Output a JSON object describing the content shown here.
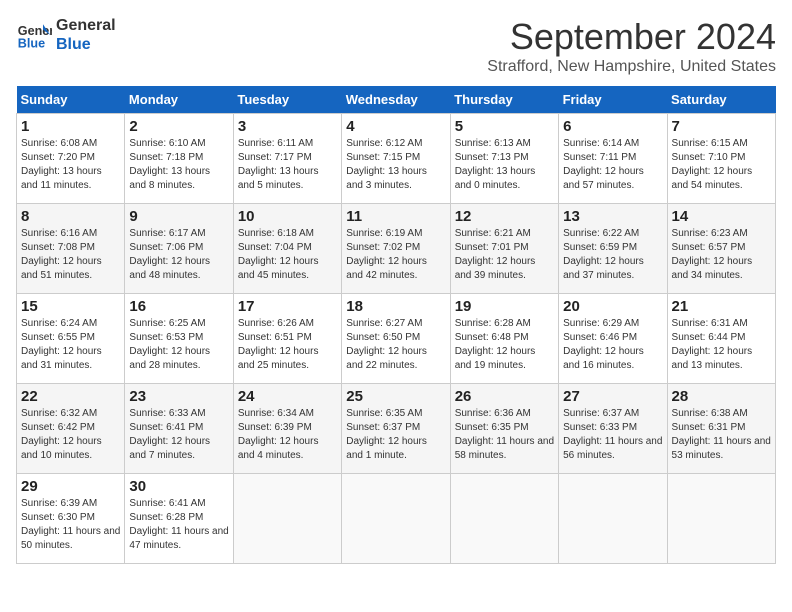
{
  "header": {
    "logo_general": "General",
    "logo_blue": "Blue",
    "month": "September 2024",
    "location": "Strafford, New Hampshire, United States"
  },
  "days_of_week": [
    "Sunday",
    "Monday",
    "Tuesday",
    "Wednesday",
    "Thursday",
    "Friday",
    "Saturday"
  ],
  "weeks": [
    [
      {
        "day": "1",
        "sunrise": "6:08 AM",
        "sunset": "7:20 PM",
        "daylight": "13 hours and 11 minutes."
      },
      {
        "day": "2",
        "sunrise": "6:10 AM",
        "sunset": "7:18 PM",
        "daylight": "13 hours and 8 minutes."
      },
      {
        "day": "3",
        "sunrise": "6:11 AM",
        "sunset": "7:17 PM",
        "daylight": "13 hours and 5 minutes."
      },
      {
        "day": "4",
        "sunrise": "6:12 AM",
        "sunset": "7:15 PM",
        "daylight": "13 hours and 3 minutes."
      },
      {
        "day": "5",
        "sunrise": "6:13 AM",
        "sunset": "7:13 PM",
        "daylight": "13 hours and 0 minutes."
      },
      {
        "day": "6",
        "sunrise": "6:14 AM",
        "sunset": "7:11 PM",
        "daylight": "12 hours and 57 minutes."
      },
      {
        "day": "7",
        "sunrise": "6:15 AM",
        "sunset": "7:10 PM",
        "daylight": "12 hours and 54 minutes."
      }
    ],
    [
      {
        "day": "8",
        "sunrise": "6:16 AM",
        "sunset": "7:08 PM",
        "daylight": "12 hours and 51 minutes."
      },
      {
        "day": "9",
        "sunrise": "6:17 AM",
        "sunset": "7:06 PM",
        "daylight": "12 hours and 48 minutes."
      },
      {
        "day": "10",
        "sunrise": "6:18 AM",
        "sunset": "7:04 PM",
        "daylight": "12 hours and 45 minutes."
      },
      {
        "day": "11",
        "sunrise": "6:19 AM",
        "sunset": "7:02 PM",
        "daylight": "12 hours and 42 minutes."
      },
      {
        "day": "12",
        "sunrise": "6:21 AM",
        "sunset": "7:01 PM",
        "daylight": "12 hours and 39 minutes."
      },
      {
        "day": "13",
        "sunrise": "6:22 AM",
        "sunset": "6:59 PM",
        "daylight": "12 hours and 37 minutes."
      },
      {
        "day": "14",
        "sunrise": "6:23 AM",
        "sunset": "6:57 PM",
        "daylight": "12 hours and 34 minutes."
      }
    ],
    [
      {
        "day": "15",
        "sunrise": "6:24 AM",
        "sunset": "6:55 PM",
        "daylight": "12 hours and 31 minutes."
      },
      {
        "day": "16",
        "sunrise": "6:25 AM",
        "sunset": "6:53 PM",
        "daylight": "12 hours and 28 minutes."
      },
      {
        "day": "17",
        "sunrise": "6:26 AM",
        "sunset": "6:51 PM",
        "daylight": "12 hours and 25 minutes."
      },
      {
        "day": "18",
        "sunrise": "6:27 AM",
        "sunset": "6:50 PM",
        "daylight": "12 hours and 22 minutes."
      },
      {
        "day": "19",
        "sunrise": "6:28 AM",
        "sunset": "6:48 PM",
        "daylight": "12 hours and 19 minutes."
      },
      {
        "day": "20",
        "sunrise": "6:29 AM",
        "sunset": "6:46 PM",
        "daylight": "12 hours and 16 minutes."
      },
      {
        "day": "21",
        "sunrise": "6:31 AM",
        "sunset": "6:44 PM",
        "daylight": "12 hours and 13 minutes."
      }
    ],
    [
      {
        "day": "22",
        "sunrise": "6:32 AM",
        "sunset": "6:42 PM",
        "daylight": "12 hours and 10 minutes."
      },
      {
        "day": "23",
        "sunrise": "6:33 AM",
        "sunset": "6:41 PM",
        "daylight": "12 hours and 7 minutes."
      },
      {
        "day": "24",
        "sunrise": "6:34 AM",
        "sunset": "6:39 PM",
        "daylight": "12 hours and 4 minutes."
      },
      {
        "day": "25",
        "sunrise": "6:35 AM",
        "sunset": "6:37 PM",
        "daylight": "12 hours and 1 minute."
      },
      {
        "day": "26",
        "sunrise": "6:36 AM",
        "sunset": "6:35 PM",
        "daylight": "11 hours and 58 minutes."
      },
      {
        "day": "27",
        "sunrise": "6:37 AM",
        "sunset": "6:33 PM",
        "daylight": "11 hours and 56 minutes."
      },
      {
        "day": "28",
        "sunrise": "6:38 AM",
        "sunset": "6:31 PM",
        "daylight": "11 hours and 53 minutes."
      }
    ],
    [
      {
        "day": "29",
        "sunrise": "6:39 AM",
        "sunset": "6:30 PM",
        "daylight": "11 hours and 50 minutes."
      },
      {
        "day": "30",
        "sunrise": "6:41 AM",
        "sunset": "6:28 PM",
        "daylight": "11 hours and 47 minutes."
      },
      null,
      null,
      null,
      null,
      null
    ]
  ]
}
